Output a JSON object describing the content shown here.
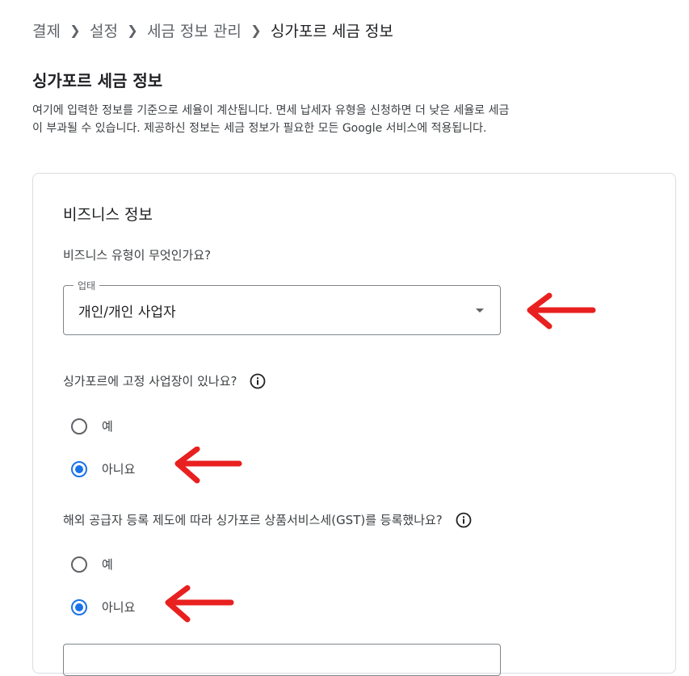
{
  "breadcrumb": {
    "items": [
      "결제",
      "설정",
      "세금 정보 관리",
      "싱가포르 세금 정보"
    ],
    "separator_icon": "chevron-right-icon"
  },
  "page": {
    "title": "싱가포르 세금 정보",
    "description": "여기에 입력한 정보를 기준으로 세율이 계산됩니다. 면세 납세자 유형을 신청하면 더 낮은 세율로 세금이 부과될 수 있습니다. 제공하신 정보는 세금 정보가 필요한 모든 Google 서비스에 적용됩니다."
  },
  "business_card": {
    "title": "비즈니스 정보",
    "q1": {
      "label": "비즈니스 유형이 무엇인가요?",
      "select_label": "업태",
      "select_value": "개인/개인 사업자"
    },
    "q2": {
      "label": "싱가포르에 고정 사업장이 있나요?",
      "options": [
        "예",
        "아니요"
      ],
      "selected": "아니요"
    },
    "q3": {
      "label": "해외 공급자 등록 제도에 따라 싱가포르 상품서비스세(GST)를 등록했나요?",
      "options": [
        "예",
        "아니요"
      ],
      "selected": "아니요"
    }
  },
  "annotation_color": "#e8201f",
  "accent_color": "#1a73e8"
}
